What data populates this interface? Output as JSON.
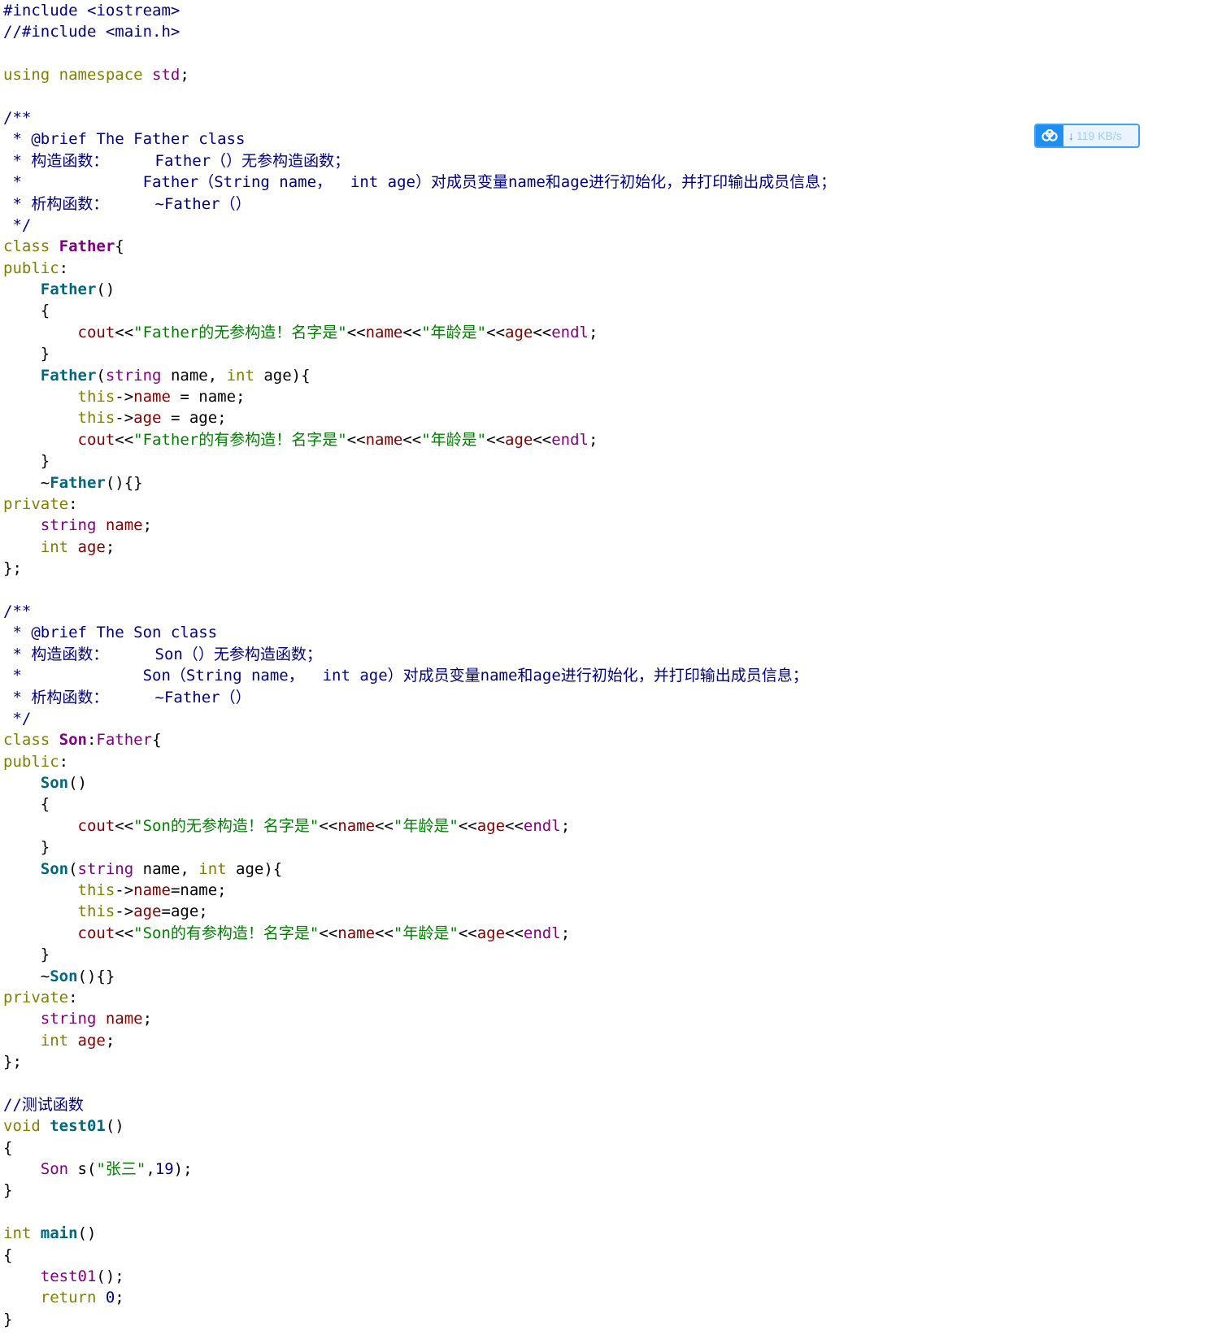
{
  "editor": {
    "language": "cpp",
    "lines": [
      [
        [
          "pp",
          "#include <iostream>"
        ]
      ],
      [
        [
          "cm",
          "//#include <main.h>"
        ]
      ],
      [],
      [
        [
          "kw",
          "using namespace "
        ],
        [
          "ty",
          "std"
        ],
        [
          "pl",
          ";"
        ]
      ],
      [],
      [
        [
          "cm",
          "/**"
        ]
      ],
      [
        [
          "cm",
          " * @brief The Father class"
        ]
      ],
      [
        [
          "cm",
          " * 构造函数：     Father（）无参构造函数；"
        ]
      ],
      [
        [
          "cm",
          " *             Father（String name，  int age）对成员变量name和age进行初始化，并打印输出成员信息；"
        ]
      ],
      [
        [
          "cm",
          " * 析构函数：     ~Father（）"
        ]
      ],
      [
        [
          "cm",
          " */"
        ]
      ],
      [
        [
          "kw",
          "class "
        ],
        [
          "cls",
          "Father"
        ],
        [
          "pl",
          "{"
        ]
      ],
      [
        [
          "kw",
          "public"
        ],
        [
          "pl",
          ":"
        ]
      ],
      [
        [
          "pl",
          "    "
        ],
        [
          "ctor",
          "Father"
        ],
        [
          "pl",
          "()"
        ]
      ],
      [
        [
          "pl",
          "    {"
        ]
      ],
      [
        [
          "pl",
          "        "
        ],
        [
          "obj",
          "cout"
        ],
        [
          "op",
          "<<"
        ],
        [
          "str",
          "\"Father的无参构造！名字是\""
        ],
        [
          "op",
          "<<"
        ],
        [
          "mem",
          "name"
        ],
        [
          "op",
          "<<"
        ],
        [
          "str",
          "\"年龄是\""
        ],
        [
          "op",
          "<<"
        ],
        [
          "mem",
          "age"
        ],
        [
          "op",
          "<<"
        ],
        [
          "ty",
          "endl"
        ],
        [
          "pl",
          ";"
        ]
      ],
      [
        [
          "pl",
          "    }"
        ]
      ],
      [
        [
          "pl",
          "    "
        ],
        [
          "ctor",
          "Father"
        ],
        [
          "pl",
          "("
        ],
        [
          "ty",
          "string"
        ],
        [
          "pl",
          " name, "
        ],
        [
          "kw",
          "int"
        ],
        [
          "pl",
          " age){"
        ]
      ],
      [
        [
          "pl",
          "        "
        ],
        [
          "kw",
          "this"
        ],
        [
          "op",
          "->"
        ],
        [
          "mem",
          "name"
        ],
        [
          "pl",
          " = name;"
        ]
      ],
      [
        [
          "pl",
          "        "
        ],
        [
          "kw",
          "this"
        ],
        [
          "op",
          "->"
        ],
        [
          "mem",
          "age"
        ],
        [
          "pl",
          " = age;"
        ]
      ],
      [
        [
          "pl",
          "        "
        ],
        [
          "obj",
          "cout"
        ],
        [
          "op",
          "<<"
        ],
        [
          "str",
          "\"Father的有参构造！名字是\""
        ],
        [
          "op",
          "<<"
        ],
        [
          "mem",
          "name"
        ],
        [
          "op",
          "<<"
        ],
        [
          "str",
          "\"年龄是\""
        ],
        [
          "op",
          "<<"
        ],
        [
          "mem",
          "age"
        ],
        [
          "op",
          "<<"
        ],
        [
          "ty",
          "endl"
        ],
        [
          "pl",
          ";"
        ]
      ],
      [
        [
          "pl",
          "    }"
        ]
      ],
      [
        [
          "pl",
          "    ~"
        ],
        [
          "ctor",
          "Father"
        ],
        [
          "pl",
          "(){}"
        ]
      ],
      [
        [
          "kw",
          "private"
        ],
        [
          "pl",
          ":"
        ]
      ],
      [
        [
          "pl",
          "    "
        ],
        [
          "ty",
          "string"
        ],
        [
          "pl",
          " "
        ],
        [
          "mem",
          "name"
        ],
        [
          "pl",
          ";"
        ]
      ],
      [
        [
          "pl",
          "    "
        ],
        [
          "kw",
          "int"
        ],
        [
          "pl",
          " "
        ],
        [
          "mem",
          "age"
        ],
        [
          "pl",
          ";"
        ]
      ],
      [
        [
          "pl",
          "};"
        ]
      ],
      [],
      [
        [
          "cm",
          "/**"
        ]
      ],
      [
        [
          "cm",
          " * @brief The Son class"
        ]
      ],
      [
        [
          "cm",
          " * 构造函数：     Son（）无参构造函数；"
        ]
      ],
      [
        [
          "cm",
          " *             Son（String name，  int age）对成员变量name和age进行初始化，并打印输出成员信息；"
        ]
      ],
      [
        [
          "cm",
          " * 析构函数：     ~Father（）"
        ]
      ],
      [
        [
          "cm",
          " */"
        ]
      ],
      [
        [
          "kw",
          "class "
        ],
        [
          "cls",
          "Son"
        ],
        [
          "pl",
          ":"
        ],
        [
          "ty",
          "Father"
        ],
        [
          "pl",
          "{"
        ]
      ],
      [
        [
          "kw",
          "public"
        ],
        [
          "pl",
          ":"
        ]
      ],
      [
        [
          "pl",
          "    "
        ],
        [
          "ctor",
          "Son"
        ],
        [
          "pl",
          "()"
        ]
      ],
      [
        [
          "pl",
          "    {"
        ]
      ],
      [
        [
          "pl",
          "        "
        ],
        [
          "obj",
          "cout"
        ],
        [
          "op",
          "<<"
        ],
        [
          "str",
          "\"Son的无参构造！名字是\""
        ],
        [
          "op",
          "<<"
        ],
        [
          "mem",
          "name"
        ],
        [
          "op",
          "<<"
        ],
        [
          "str",
          "\"年龄是\""
        ],
        [
          "op",
          "<<"
        ],
        [
          "mem",
          "age"
        ],
        [
          "op",
          "<<"
        ],
        [
          "ty",
          "endl"
        ],
        [
          "pl",
          ";"
        ]
      ],
      [
        [
          "pl",
          "    }"
        ]
      ],
      [
        [
          "pl",
          "    "
        ],
        [
          "ctor",
          "Son"
        ],
        [
          "pl",
          "("
        ],
        [
          "ty",
          "string"
        ],
        [
          "pl",
          " name, "
        ],
        [
          "kw",
          "int"
        ],
        [
          "pl",
          " age){"
        ]
      ],
      [
        [
          "pl",
          "        "
        ],
        [
          "kw",
          "this"
        ],
        [
          "op",
          "->"
        ],
        [
          "mem",
          "name"
        ],
        [
          "pl",
          "=name;"
        ]
      ],
      [
        [
          "pl",
          "        "
        ],
        [
          "kw",
          "this"
        ],
        [
          "op",
          "->"
        ],
        [
          "mem",
          "age"
        ],
        [
          "pl",
          "=age;"
        ]
      ],
      [
        [
          "pl",
          "        "
        ],
        [
          "obj",
          "cout"
        ],
        [
          "op",
          "<<"
        ],
        [
          "str",
          "\"Son的有参构造！名字是\""
        ],
        [
          "op",
          "<<"
        ],
        [
          "mem",
          "name"
        ],
        [
          "op",
          "<<"
        ],
        [
          "str",
          "\"年龄是\""
        ],
        [
          "op",
          "<<"
        ],
        [
          "mem",
          "age"
        ],
        [
          "op",
          "<<"
        ],
        [
          "ty",
          "endl"
        ],
        [
          "pl",
          ";"
        ]
      ],
      [
        [
          "pl",
          "    }"
        ]
      ],
      [
        [
          "pl",
          "    ~"
        ],
        [
          "ctor",
          "Son"
        ],
        [
          "pl",
          "(){}"
        ]
      ],
      [
        [
          "kw",
          "private"
        ],
        [
          "pl",
          ":"
        ]
      ],
      [
        [
          "pl",
          "    "
        ],
        [
          "ty",
          "string"
        ],
        [
          "pl",
          " "
        ],
        [
          "mem",
          "name"
        ],
        [
          "pl",
          ";"
        ]
      ],
      [
        [
          "pl",
          "    "
        ],
        [
          "kw",
          "int"
        ],
        [
          "pl",
          " "
        ],
        [
          "mem",
          "age"
        ],
        [
          "pl",
          ";"
        ]
      ],
      [
        [
          "pl",
          "};"
        ]
      ],
      [],
      [
        [
          "cm",
          "//测试函数"
        ]
      ],
      [
        [
          "kw",
          "void "
        ],
        [
          "fn",
          "test01"
        ],
        [
          "pl",
          "()"
        ]
      ],
      [
        [
          "pl",
          "{"
        ]
      ],
      [
        [
          "pl",
          "    "
        ],
        [
          "ty",
          "Son"
        ],
        [
          "pl",
          " s("
        ],
        [
          "str",
          "\"张三\""
        ],
        [
          "pl",
          ","
        ],
        [
          "num",
          "19"
        ],
        [
          "pl",
          ");"
        ]
      ],
      [
        [
          "pl",
          "}"
        ]
      ],
      [],
      [
        [
          "kw",
          "int "
        ],
        [
          "fn",
          "main"
        ],
        [
          "pl",
          "()"
        ]
      ],
      [
        [
          "pl",
          "{"
        ]
      ],
      [
        [
          "pl",
          "    "
        ],
        [
          "ty",
          "test01"
        ],
        [
          "pl",
          "();"
        ]
      ],
      [
        [
          "pl",
          "    "
        ],
        [
          "kw",
          "return "
        ],
        [
          "num",
          "0"
        ],
        [
          "pl",
          ";"
        ]
      ],
      [
        [
          "pl",
          "}"
        ]
      ]
    ]
  },
  "download_badge": {
    "icon": "baidu-netdisk-cloud-icon",
    "speed_text": "119 KB/s",
    "arrow": "↓",
    "accent_color": "#1e8ff0"
  }
}
